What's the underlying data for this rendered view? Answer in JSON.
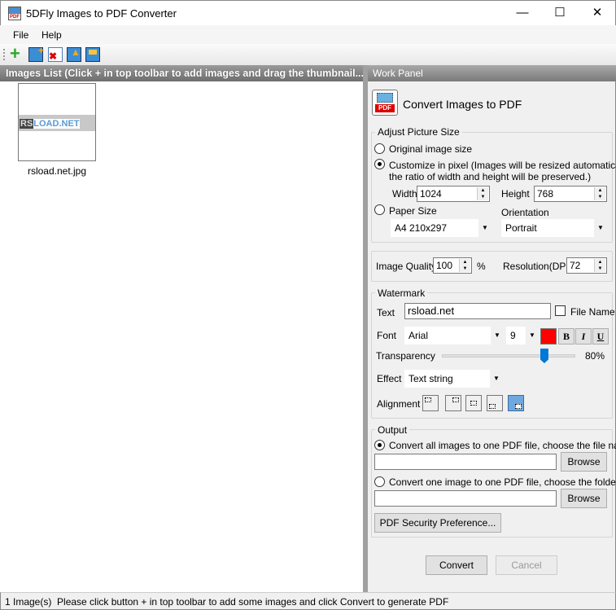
{
  "window": {
    "title": "5DFly Images to PDF Converter",
    "minimize": "—",
    "maximize": "☐",
    "close": "✕"
  },
  "menu": [
    "File",
    "Help"
  ],
  "toolbar": {
    "icons": [
      "add-icon",
      "add-folder-icon",
      "remove-icon",
      "open-folder-icon",
      "save-icon"
    ]
  },
  "images_list": {
    "header": "Images List (Click + in top toolbar to add images and drag the thumbnail...",
    "items": [
      {
        "filename": "rsload.net.jpg",
        "thumb_text_a": "RS",
        "thumb_text_b": "LOAD.NET"
      }
    ]
  },
  "work_panel": {
    "header": "Work Panel",
    "title": "Convert Images to PDF",
    "icon_label": "PDF",
    "adjust": {
      "legend": "Adjust Picture Size",
      "original": "Original image size",
      "customize_1": "Customize in pixel (Images will be resized automatically,",
      "customize_2": "the ratio of width and height will be preserved.)",
      "width_label": "Width",
      "width": "1024",
      "height_label": "Height",
      "height": "768",
      "paper_label": "Paper Size",
      "paper": "A4 210x297",
      "orientation_label": "Orientation",
      "orientation": "Portrait",
      "selected": "customize"
    },
    "quality": {
      "label": "Image Quality",
      "value": "100",
      "unit": "%",
      "dpi_label": "Resolution(DPI)",
      "dpi": "72"
    },
    "watermark": {
      "legend": "Watermark",
      "text_label": "Text",
      "text": "rsload.net",
      "filename_label": "File Name",
      "font_label": "Font",
      "font": "Arial",
      "size": "9",
      "color": "#ff0000",
      "bold": "B",
      "italic": "I",
      "underline": "U",
      "transparency_label": "Transparency",
      "transparency": "80%",
      "transparency_value": 80,
      "effect_label": "Effect",
      "effect": "Text string",
      "alignment_label": "Alignment",
      "alignment_selected": 4
    },
    "output": {
      "legend": "Output",
      "all_one": "Convert all images to one PDF file, choose the file name:",
      "one_one": "Convert one image to one PDF file, choose the folder:",
      "browse": "Browse",
      "security": "PDF Security Preference..."
    },
    "convert": "Convert",
    "cancel": "Cancel"
  },
  "status": "1 Image(s)  Please click button + in top toolbar to add some images and click Convert to generate PDF"
}
